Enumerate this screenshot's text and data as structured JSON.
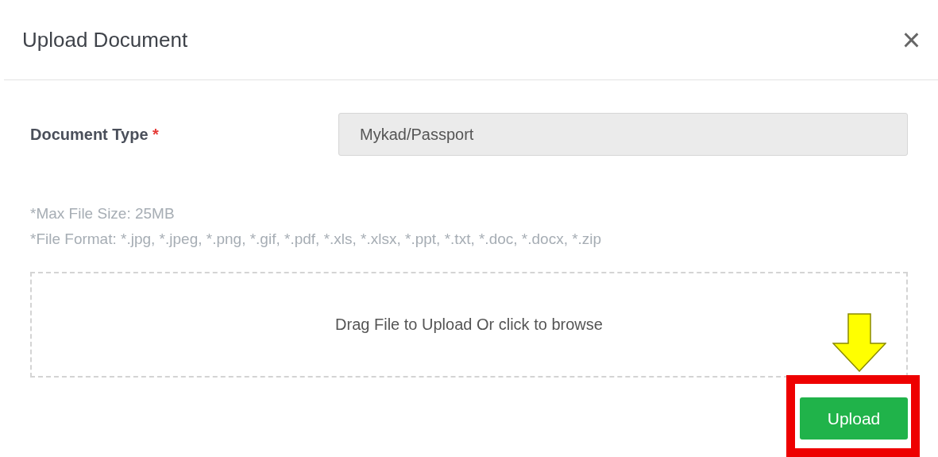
{
  "dialog": {
    "title": "Upload Document",
    "close": "×"
  },
  "document_type": {
    "label": "Document Type",
    "required": true,
    "required_mark": "*",
    "value": "Mykad/Passport"
  },
  "notes": [
    "*Max File Size: 25MB",
    "*File Format: *.jpg, *.jpeg, *.png, *.gif, *.pdf, *.xls, *.xlsx, *.ppt, *.txt, *.doc, *.docx, *.zip"
  ],
  "dropzone": {
    "text": "Drag File to Upload Or click to browse"
  },
  "buttons": [
    {
      "label": "Upload",
      "highlighted": true
    }
  ]
}
